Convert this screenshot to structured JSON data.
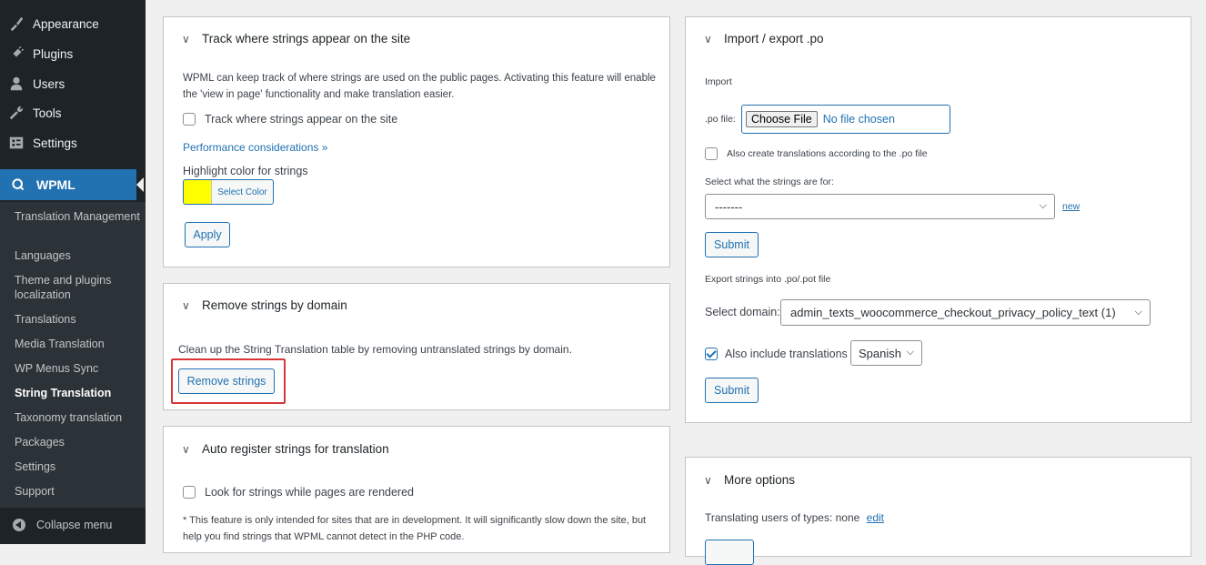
{
  "sidebar": {
    "items": [
      {
        "label": "Appearance",
        "icon": "paintbrush-icon"
      },
      {
        "label": "Plugins",
        "icon": "plugin-icon"
      },
      {
        "label": "Users",
        "icon": "users-icon"
      },
      {
        "label": "Tools",
        "icon": "wrench-icon"
      },
      {
        "label": "Settings",
        "icon": "settings-icon"
      }
    ],
    "active": {
      "label": "WPML",
      "icon": "wpml-icon"
    },
    "submenu": [
      "Translation Management",
      "Languages",
      "Theme and plugins localization",
      "Translations",
      "Media Translation",
      "WP Menus Sync",
      "String Translation",
      "Taxonomy translation",
      "Packages",
      "Settings",
      "Support"
    ],
    "current_submenu": "String Translation",
    "collapse_label": "Collapse menu"
  },
  "track": {
    "title": "Track where strings appear on the site",
    "description": "WPML can keep track of where strings are used on the public pages. Activating this feature will enable the 'view in page' functionality and make translation easier.",
    "checkbox_label": "Track where strings appear on the site",
    "checkbox_checked": false,
    "performance_link": "Performance considerations »",
    "highlight_label": "Highlight color for strings",
    "highlight_color": "#ffff00",
    "select_color_label": "Select Color",
    "apply_label": "Apply"
  },
  "remove": {
    "title": "Remove strings by domain",
    "description": "Clean up the String Translation table by removing untranslated strings by domain.",
    "button_label": "Remove strings",
    "highlight_border": "#d63638"
  },
  "auto": {
    "title": "Auto register strings for translation",
    "checkbox_label": "Look for strings while pages are rendered",
    "checkbox_checked": false,
    "note": "* This feature is only intended for sites that are in development. It will significantly slow down the site, but help you find strings that WPML cannot detect in the PHP code."
  },
  "import_export": {
    "title": "Import / export .po",
    "import_heading": "Import",
    "po_file_label": ".po file:",
    "choose_file_label": "Choose File",
    "no_file_label": "No file chosen",
    "also_create_label": "Also create translations according to the .po file",
    "also_create_checked": false,
    "select_for_label": "Select what the strings are for:",
    "select_for_value": "-------",
    "new_link": "new",
    "submit_label": "Submit",
    "export_heading": "Export strings into .po/.pot file",
    "select_domain_label": "Select domain:",
    "domain_value": "admin_texts_woocommerce_checkout_privacy_policy_text (1)",
    "include_translations_label": "Also include translations",
    "include_translations_checked": true,
    "language_value": "Spanish",
    "submit2_label": "Submit"
  },
  "more": {
    "title": "More options",
    "translating_users_label": "Translating users of types: none",
    "edit_link": "edit"
  }
}
